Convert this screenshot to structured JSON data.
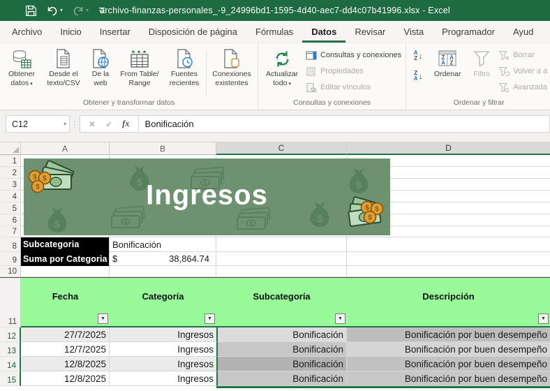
{
  "title_bar": {
    "title": "archivo-finanzas-personales_-9_24996bd1-1595-4d40-aec7-dd4c07b41996.xlsx - Excel"
  },
  "ribbon": {
    "tabs": [
      "Archivo",
      "Inicio",
      "Insertar",
      "Disposición de página",
      "Fórmulas",
      "Datos",
      "Revisar",
      "Vista",
      "Programador",
      "Ayud"
    ],
    "active_tab": "Datos",
    "group1": {
      "label": "Obtener y transformar datos",
      "buttons": [
        "Obtener datos",
        "Desde el texto/CSV",
        "De la web",
        "From Table/ Range",
        "Fuentes recientes",
        "Conexiones existentes"
      ]
    },
    "group2": {
      "label": "Consultas y conexiones",
      "big_button": "Actualizar todo",
      "items": [
        "Consultas y conexiones",
        "Propiedades",
        "Editar vínculos"
      ]
    },
    "group3": {
      "label": "Ordenar y filtrar",
      "big_buttons": [
        "Ordenar",
        "Filtro"
      ],
      "items": [
        "Borrar",
        "Volver a a",
        "Avanzada"
      ]
    }
  },
  "formula_bar": {
    "name_box": "C12",
    "formula": "Bonificación"
  },
  "sheet": {
    "column_headers": [
      "A",
      "B",
      "C",
      "D"
    ],
    "selected_columns": [
      "C",
      "D"
    ],
    "active_cell": "C12",
    "row_numbers": [
      "1",
      "2",
      "3",
      "4",
      "5",
      "6",
      "7",
      "8",
      "9",
      "10",
      "11",
      "12",
      "13",
      "14",
      "15"
    ],
    "banner": {
      "title": "Ingresos"
    },
    "summary": {
      "row8_label": "Subcategoria",
      "row8_value": "Bonificación",
      "row9_label": "Suma por Categoria",
      "row9_currency": "$",
      "row9_value": "38,864.74"
    },
    "table": {
      "headers": [
        "Fecha",
        "Categoría",
        "Subcategoría",
        "Descripción"
      ],
      "rows": [
        [
          "27/7/2025",
          "Ingresos",
          "Bonificación",
          "Bonificación por buen desempeño"
        ],
        [
          "12/7/2025",
          "Ingresos",
          "Bonificación",
          "Bonificación por buen desempeño"
        ],
        [
          "12/8/2025",
          "Ingresos",
          "Bonificación",
          "Bonificación por buen desempeño"
        ],
        [
          "12/8/2025",
          "Ingresos",
          "Bonificación",
          "Bonificación por buen desempeño"
        ]
      ]
    }
  },
  "icons": {
    "dropdown_caret": "▾",
    "name_caret": "▾",
    "filter_caret": "▼",
    "cancel": "✕",
    "check": "✓",
    "fx": "fx",
    "dots": "⋮",
    "sort_arrow": "↓",
    "sort_A": "A",
    "sort_Z": "Z"
  },
  "colors": {
    "title_bar_green": "#1e6b41",
    "excel_accent_green": "#217346",
    "banner_green": "#6e9270",
    "table_header_green": "#98fa98",
    "black_label_cell": "#000000"
  }
}
